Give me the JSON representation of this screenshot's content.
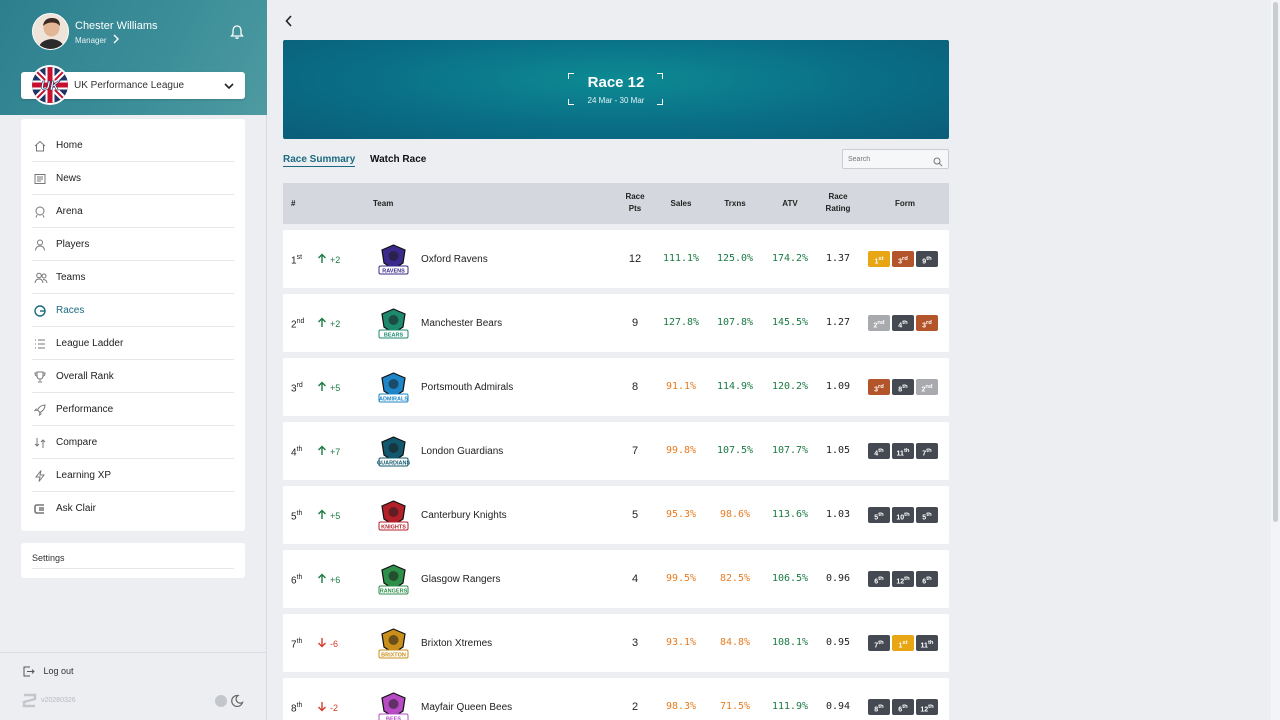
{
  "user": {
    "name": "Chester Williams",
    "role": "Manager"
  },
  "league": {
    "name": "UK Performance League",
    "logo_text": "UK"
  },
  "nav": [
    {
      "label": "Home",
      "icon": "home-icon",
      "active": false
    },
    {
      "label": "News",
      "icon": "news-icon",
      "active": false
    },
    {
      "label": "Arena",
      "icon": "arena-icon",
      "active": false
    },
    {
      "label": "Players",
      "icon": "user-icon",
      "active": false
    },
    {
      "label": "Teams",
      "icon": "users-icon",
      "active": false
    },
    {
      "label": "Races",
      "icon": "races-icon",
      "active": true
    },
    {
      "label": "League Ladder",
      "icon": "list-icon",
      "active": false
    },
    {
      "label": "Overall Rank",
      "icon": "trophy-icon",
      "active": false
    },
    {
      "label": "Performance",
      "icon": "rocket-icon",
      "active": false
    },
    {
      "label": "Compare",
      "icon": "compare-icon",
      "active": false
    },
    {
      "label": "Learning XP",
      "icon": "bolt-icon",
      "active": false
    },
    {
      "label": "Ask Clair",
      "icon": "clair-icon",
      "active": false
    }
  ],
  "settings_label": "Settings",
  "logout_label": "Log out",
  "version": "v20280326",
  "banner": {
    "title": "Race 12",
    "dates": "24 Mar - 30 Mar"
  },
  "tabs": {
    "summary": "Race Summary",
    "watch": "Watch Race"
  },
  "search": {
    "placeholder": "Search"
  },
  "table": {
    "headers": {
      "rank": "#",
      "team": "Team",
      "pts_l1": "Race",
      "pts_l2": "Pts",
      "sales": "Sales",
      "trxns": "Trxns",
      "atv": "ATV",
      "rating_l1": "Race",
      "rating_l2": "Rating",
      "form": "Form"
    },
    "rows": [
      {
        "pos": "1",
        "suf": "st",
        "chg": "+2",
        "dir": "up",
        "team": "Oxford Ravens",
        "crest": "RAVENS",
        "crest_color": "#3b2a8c",
        "pts": "12",
        "sales": "111.1%",
        "sales_c": "g",
        "trxns": "125.0%",
        "trxns_c": "g",
        "atv": "174.2%",
        "atv_c": "g",
        "rating": "1.37",
        "form": [
          {
            "n": "1",
            "s": "st",
            "c": "gold"
          },
          {
            "n": "3",
            "s": "rd",
            "c": "bronze"
          },
          {
            "n": "9",
            "s": "th",
            "c": "dark"
          }
        ]
      },
      {
        "pos": "2",
        "suf": "nd",
        "chg": "+2",
        "dir": "up",
        "team": "Manchester Bears",
        "crest": "BEARS",
        "crest_color": "#1d8a6e",
        "pts": "9",
        "sales": "127.8%",
        "sales_c": "g",
        "trxns": "107.8%",
        "trxns_c": "g",
        "atv": "145.5%",
        "atv_c": "g",
        "rating": "1.27",
        "form": [
          {
            "n": "2",
            "s": "nd",
            "c": "silver"
          },
          {
            "n": "4",
            "s": "th",
            "c": "dark"
          },
          {
            "n": "3",
            "s": "rd",
            "c": "bronze"
          }
        ]
      },
      {
        "pos": "3",
        "suf": "rd",
        "chg": "+5",
        "dir": "up",
        "team": "Portsmouth Admirals",
        "crest": "ADMIRALS",
        "crest_color": "#1e86c8",
        "pts": "8",
        "sales": "91.1%",
        "sales_c": "o",
        "trxns": "114.9%",
        "trxns_c": "g",
        "atv": "120.2%",
        "atv_c": "g",
        "rating": "1.09",
        "form": [
          {
            "n": "3",
            "s": "rd",
            "c": "bronze"
          },
          {
            "n": "8",
            "s": "th",
            "c": "dark"
          },
          {
            "n": "2",
            "s": "nd",
            "c": "silver"
          }
        ]
      },
      {
        "pos": "4",
        "suf": "th",
        "chg": "+7",
        "dir": "up",
        "team": "London Guardians",
        "crest": "GUARDIANS",
        "crest_color": "#12586e",
        "pts": "7",
        "sales": "99.8%",
        "sales_c": "o",
        "trxns": "107.5%",
        "trxns_c": "g",
        "atv": "107.7%",
        "atv_c": "g",
        "rating": "1.05",
        "form": [
          {
            "n": "4",
            "s": "th",
            "c": "dark"
          },
          {
            "n": "11",
            "s": "th",
            "c": "dark"
          },
          {
            "n": "7",
            "s": "th",
            "c": "dark"
          }
        ]
      },
      {
        "pos": "5",
        "suf": "th",
        "chg": "+5",
        "dir": "up",
        "team": "Canterbury Knights",
        "crest": "KNIGHTS",
        "crest_color": "#b3202a",
        "pts": "5",
        "sales": "95.3%",
        "sales_c": "o",
        "trxns": "98.6%",
        "trxns_c": "o",
        "atv": "113.6%",
        "atv_c": "g",
        "rating": "1.03",
        "form": [
          {
            "n": "5",
            "s": "th",
            "c": "dark"
          },
          {
            "n": "10",
            "s": "th",
            "c": "dark"
          },
          {
            "n": "5",
            "s": "th",
            "c": "dark"
          }
        ]
      },
      {
        "pos": "6",
        "suf": "th",
        "chg": "+6",
        "dir": "up",
        "team": "Glasgow Rangers",
        "crest": "RANGERS",
        "crest_color": "#2e8f4a",
        "pts": "4",
        "sales": "99.5%",
        "sales_c": "o",
        "trxns": "82.5%",
        "trxns_c": "o",
        "atv": "106.5%",
        "atv_c": "g",
        "rating": "0.96",
        "form": [
          {
            "n": "6",
            "s": "th",
            "c": "dark"
          },
          {
            "n": "12",
            "s": "th",
            "c": "dark"
          },
          {
            "n": "6",
            "s": "th",
            "c": "dark"
          }
        ]
      },
      {
        "pos": "7",
        "suf": "th",
        "chg": "-6",
        "dir": "down",
        "team": "Brixton Xtremes",
        "crest": "BRIXTON",
        "crest_color": "#c98f1a",
        "pts": "3",
        "sales": "93.1%",
        "sales_c": "o",
        "trxns": "84.8%",
        "trxns_c": "o",
        "atv": "108.1%",
        "atv_c": "g",
        "rating": "0.95",
        "form": [
          {
            "n": "7",
            "s": "th",
            "c": "dark"
          },
          {
            "n": "1",
            "s": "st",
            "c": "gold"
          },
          {
            "n": "11",
            "s": "th",
            "c": "dark"
          }
        ]
      },
      {
        "pos": "8",
        "suf": "th",
        "chg": "-2",
        "dir": "down",
        "team": "Mayfair Queen Bees",
        "crest": "BEES",
        "crest_color": "#b64bc4",
        "pts": "2",
        "sales": "98.3%",
        "sales_c": "o",
        "trxns": "71.5%",
        "trxns_c": "o",
        "atv": "111.9%",
        "atv_c": "g",
        "rating": "0.94",
        "form": [
          {
            "n": "8",
            "s": "th",
            "c": "dark"
          },
          {
            "n": "6",
            "s": "th",
            "c": "dark"
          },
          {
            "n": "12",
            "s": "th",
            "c": "dark"
          }
        ]
      }
    ]
  },
  "colors": {
    "accent": "#1b6a80",
    "positive": "#1a7a44",
    "warning": "#e87c22",
    "negative": "#d33b2c"
  }
}
